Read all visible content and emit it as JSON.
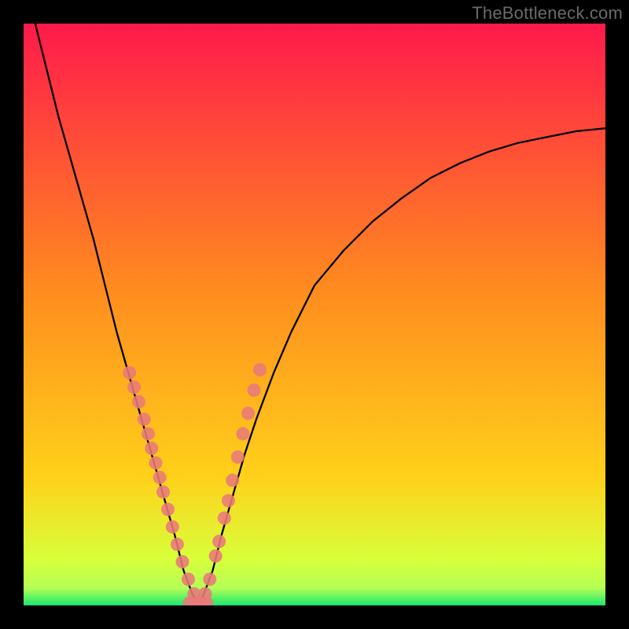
{
  "watermark": "TheBottleneck.com",
  "chart_data": {
    "type": "line",
    "title": "",
    "xlabel": "",
    "ylabel": "",
    "xlim": [
      0,
      1
    ],
    "ylim": [
      0,
      1
    ],
    "annotations": [],
    "background_gradient": {
      "top_color": "#ff1a4b",
      "mid_color": "#ffd11a",
      "bottom_band_color": "#b6ff55",
      "bottom_edge_color": "#19e86f"
    },
    "series": [
      {
        "name": "bottleneck-curve",
        "type": "line",
        "x": [
          0.02,
          0.04,
          0.06,
          0.08,
          0.1,
          0.12,
          0.14,
          0.16,
          0.18,
          0.2,
          0.22,
          0.24,
          0.26,
          0.275,
          0.29,
          0.3,
          0.31,
          0.325,
          0.34,
          0.36,
          0.38,
          0.4,
          0.43,
          0.46,
          0.5,
          0.55,
          0.6,
          0.65,
          0.7,
          0.75,
          0.8,
          0.85,
          0.9,
          0.95,
          1.0
        ],
        "y": [
          1.0,
          0.92,
          0.84,
          0.77,
          0.7,
          0.63,
          0.55,
          0.47,
          0.4,
          0.33,
          0.26,
          0.19,
          0.12,
          0.06,
          0.02,
          0.0,
          0.02,
          0.06,
          0.12,
          0.19,
          0.26,
          0.32,
          0.4,
          0.47,
          0.55,
          0.61,
          0.66,
          0.7,
          0.735,
          0.76,
          0.78,
          0.795,
          0.805,
          0.815,
          0.82
        ]
      },
      {
        "name": "left-branch-points",
        "type": "scatter",
        "color": "#e97a7a",
        "x": [
          0.182,
          0.19,
          0.198,
          0.207,
          0.214,
          0.22,
          0.227,
          0.234,
          0.24,
          0.248,
          0.256,
          0.264,
          0.273,
          0.283,
          0.293,
          0.301
        ],
        "y": [
          0.4,
          0.375,
          0.35,
          0.32,
          0.295,
          0.27,
          0.245,
          0.22,
          0.195,
          0.165,
          0.135,
          0.105,
          0.075,
          0.045,
          0.02,
          0.005
        ]
      },
      {
        "name": "right-branch-points",
        "type": "scatter",
        "color": "#e97a7a",
        "x": [
          0.312,
          0.32,
          0.33,
          0.336,
          0.345,
          0.352,
          0.359,
          0.368,
          0.377,
          0.386,
          0.396,
          0.406
        ],
        "y": [
          0.02,
          0.045,
          0.085,
          0.11,
          0.15,
          0.18,
          0.215,
          0.255,
          0.295,
          0.33,
          0.37,
          0.405
        ]
      },
      {
        "name": "valley-floor-points",
        "type": "scatter",
        "color": "#e97a7a",
        "x": [
          0.285,
          0.293,
          0.3,
          0.307,
          0.315
        ],
        "y": [
          0.004,
          0.001,
          0.0,
          0.001,
          0.004
        ]
      }
    ]
  }
}
